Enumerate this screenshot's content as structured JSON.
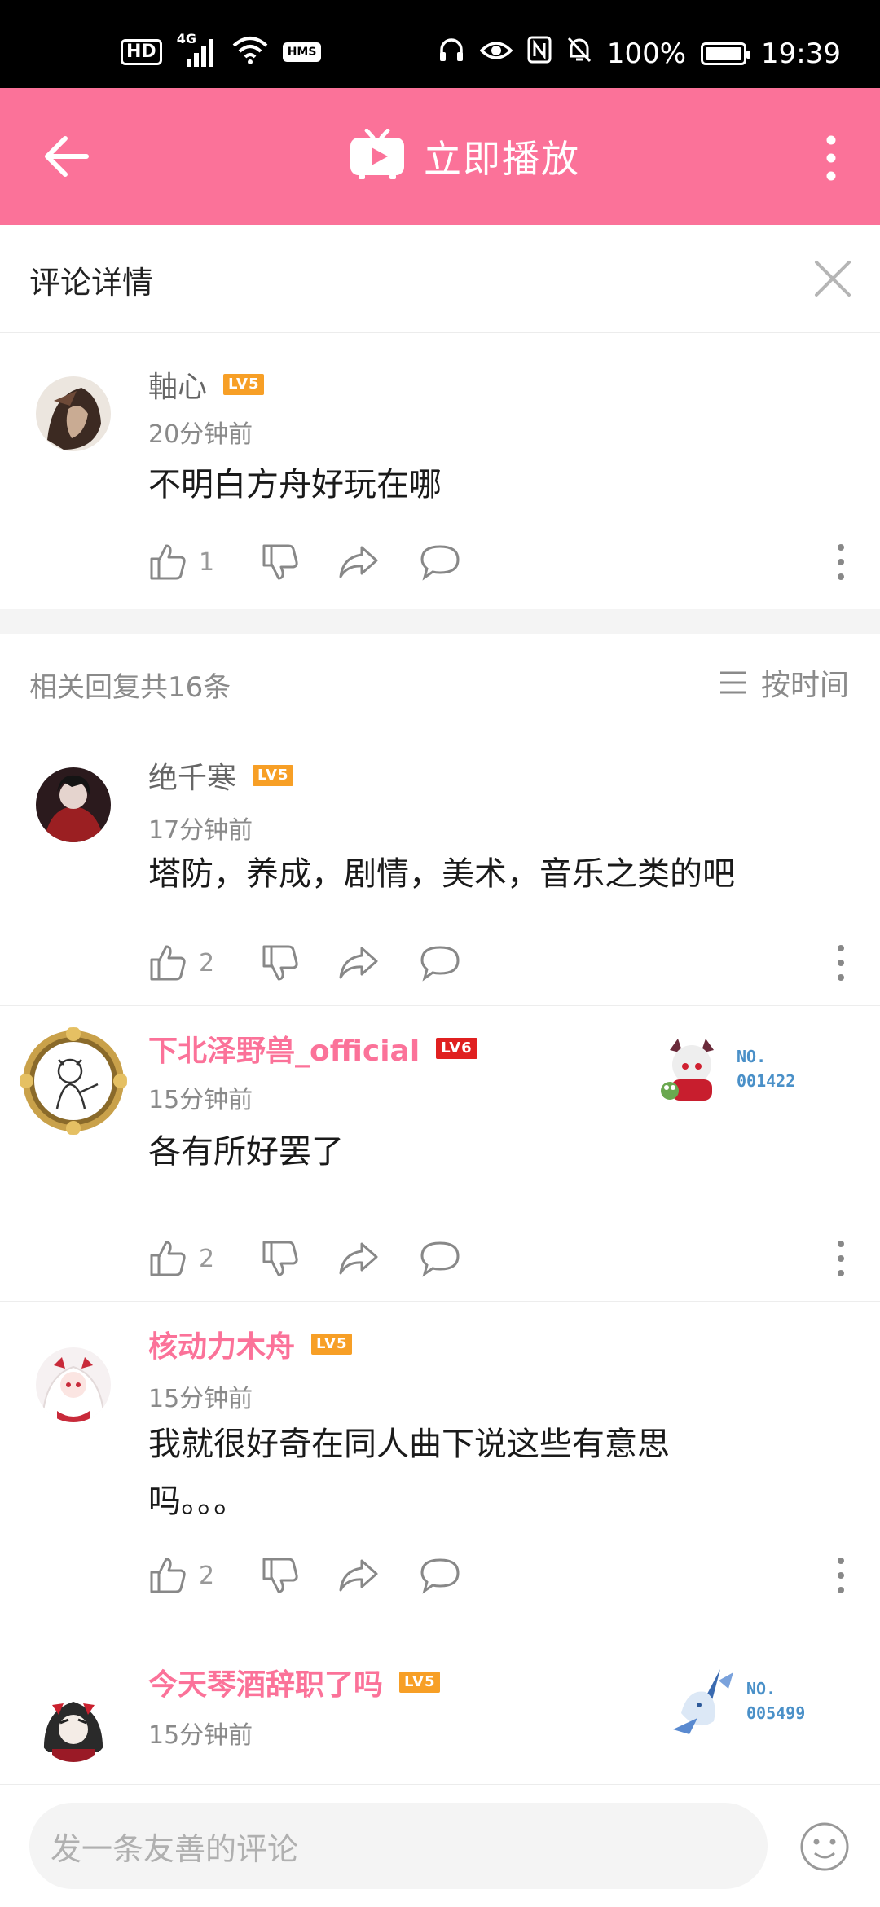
{
  "status_bar": {
    "hd": "HD",
    "net": "4G",
    "hms": "HMS",
    "battery": "100%",
    "time": "19:39"
  },
  "appbar": {
    "title": "立即播放"
  },
  "panel": {
    "title": "评论详情"
  },
  "main_comment": {
    "username": "軸心",
    "level": "LV5",
    "time": "20分钟前",
    "text": "不明白方舟好玩在哪",
    "likes": "1"
  },
  "replies_header": {
    "count_text": "相关回复共16条",
    "sort_label": "按时间"
  },
  "replies": [
    {
      "username": "绝千寒",
      "level": "LV5",
      "time": "17分钟前",
      "text": "塔防，养成，剧情，美术，音乐之类的吧",
      "likes": "2"
    },
    {
      "username": "下北泽野兽_official",
      "level": "LV6",
      "time": "15分钟前",
      "text": "各有所好罢了",
      "likes": "2",
      "fan_no_label": "NO.",
      "fan_no": "001422"
    },
    {
      "username": "核动力木舟",
      "level": "LV5",
      "time": "15分钟前",
      "text": "我就很好奇在同人曲下说这些有意思吗。。。",
      "likes": "2"
    },
    {
      "username": "今天琴酒辞职了吗",
      "level": "LV5",
      "time": "15分钟前",
      "fan_no_label": "NO.",
      "fan_no": "005499"
    }
  ],
  "bottom": {
    "placeholder": "发一条友善的评论"
  },
  "colors": {
    "brand": "#fb7299",
    "lv5": "#f79f26",
    "lv6": "#e02020",
    "fan": "#4a90c8"
  }
}
